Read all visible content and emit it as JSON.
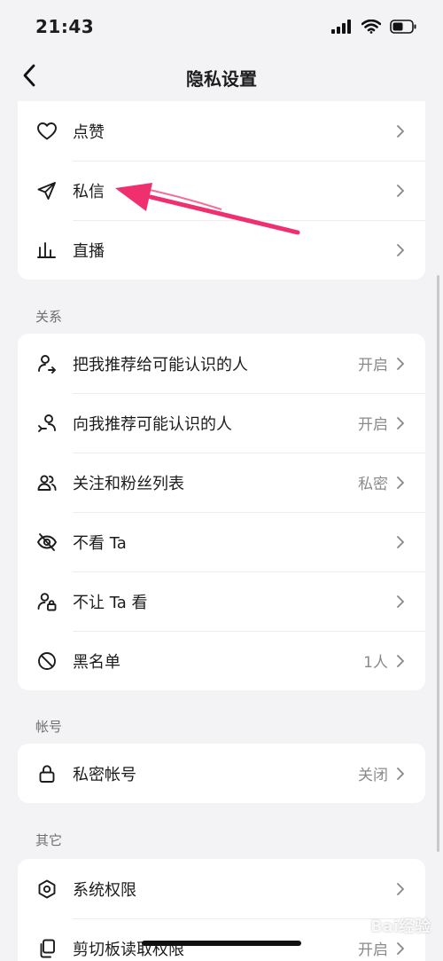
{
  "status_bar": {
    "time": "21:43"
  },
  "nav": {
    "title": "隐私设置"
  },
  "group_top": {
    "items": [
      {
        "label": "点赞",
        "value": ""
      },
      {
        "label": "私信",
        "value": ""
      },
      {
        "label": "直播",
        "value": ""
      }
    ]
  },
  "section_relations": {
    "title": "关系",
    "items": [
      {
        "label": "把我推荐给可能认识的人",
        "value": "开启"
      },
      {
        "label": "向我推荐可能认识的人",
        "value": "开启"
      },
      {
        "label": "关注和粉丝列表",
        "value": "私密"
      },
      {
        "label": "不看 Ta",
        "value": ""
      },
      {
        "label": "不让 Ta 看",
        "value": ""
      },
      {
        "label": "黑名单",
        "value": "1人"
      }
    ]
  },
  "section_account": {
    "title": "帐号",
    "items": [
      {
        "label": "私密帐号",
        "value": "关闭"
      }
    ]
  },
  "section_other": {
    "title": "其它",
    "items": [
      {
        "label": "系统权限",
        "value": ""
      },
      {
        "label": "剪切板读取权限",
        "value": "开启"
      }
    ]
  },
  "watermark": "Bai经验",
  "colors": {
    "annotation_arrow": "#f0306e",
    "text": "#1c1c1e",
    "secondary": "#8a8a8e",
    "background": "#f3f3f6"
  }
}
